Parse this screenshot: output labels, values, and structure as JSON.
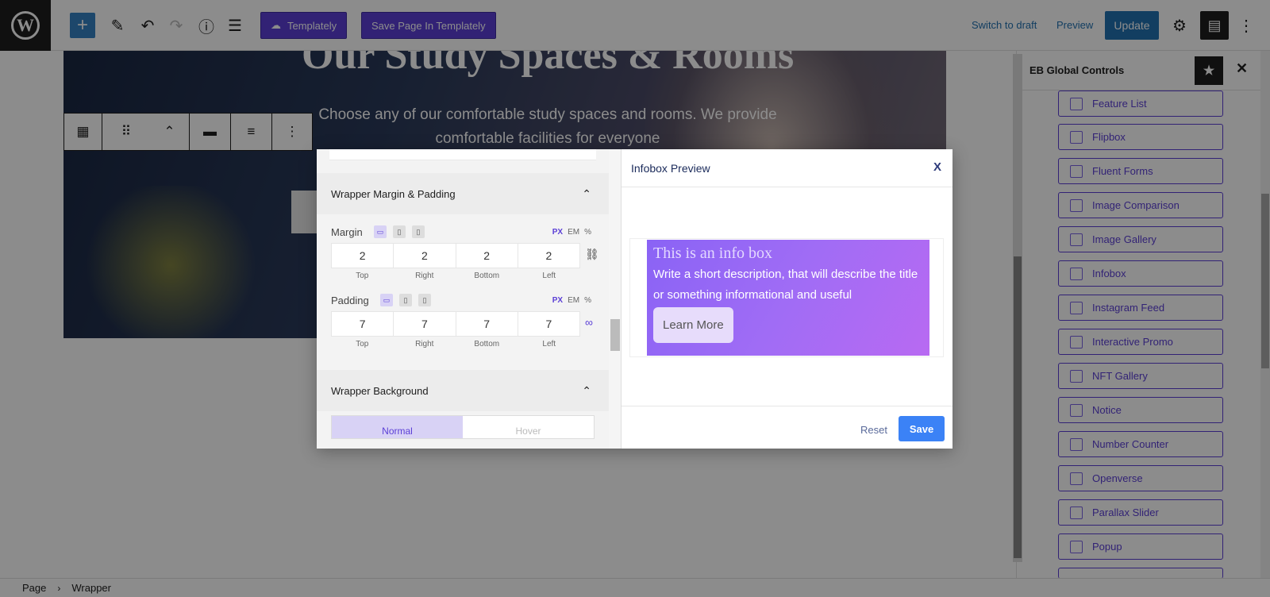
{
  "topbar": {
    "logo": "W",
    "add_icon": "+",
    "pen_icon": "✎",
    "undo_icon": "↶",
    "redo_icon": "↷",
    "info_icon": "ⓘ",
    "list_icon": "☰",
    "templately_label": "Templately",
    "save_templately_label": "Save Page In Templately",
    "switch_draft": "Switch to draft",
    "preview": "Preview",
    "update": "Update",
    "settings_icon": "⚙",
    "eb_icon": "▤",
    "more_icon": "⋮"
  },
  "hero": {
    "title": "Our Study Spaces & Rooms",
    "subtitle": "Choose any of our comfortable study spaces and rooms. We provide comfortable facilities for everyone"
  },
  "block_toolbar": {
    "block_icon": "▦",
    "drag_icon": "⠿",
    "move_icon": "⌃",
    "align_icon": "▬",
    "justify_icon": "≡",
    "more_icon": "⋮"
  },
  "sidebar": {
    "title": "EB Global Controls",
    "star_icon": "★",
    "close_icon": "✕",
    "items": [
      {
        "label": "Feature List"
      },
      {
        "label": "Flipbox"
      },
      {
        "label": "Fluent Forms"
      },
      {
        "label": "Image Comparison"
      },
      {
        "label": "Image Gallery"
      },
      {
        "label": "Infobox"
      },
      {
        "label": "Instagram Feed"
      },
      {
        "label": "Interactive Promo"
      },
      {
        "label": "NFT Gallery"
      },
      {
        "label": "Notice"
      },
      {
        "label": "Number Counter"
      },
      {
        "label": "Openverse"
      },
      {
        "label": "Parallax Slider"
      },
      {
        "label": "Popup"
      }
    ]
  },
  "footer": {
    "page": "Page",
    "separator": "›",
    "wrapper": "Wrapper"
  },
  "modal": {
    "section1_title": "Wrapper Margin & Padding",
    "section2_title": "Wrapper Background",
    "chevron": "⌃",
    "margin_label": "Margin",
    "padding_label": "Padding",
    "units": {
      "px": "PX",
      "em": "EM",
      "pct": "%"
    },
    "margin": {
      "top": "2",
      "right": "2",
      "bottom": "2",
      "left": "2"
    },
    "padding": {
      "top": "7",
      "right": "7",
      "bottom": "7",
      "left": "7"
    },
    "dim_labels": {
      "top": "Top",
      "right": "Right",
      "bottom": "Bottom",
      "left": "Left"
    },
    "unlink_icon": "⛓",
    "link_icon": "🔗",
    "tab_normal": "Normal",
    "tab_hover": "Hover",
    "preview_title": "Infobox Preview",
    "close": "X",
    "infobox_title": "This is an info box",
    "infobox_desc": "Write a short description, that will describe the title or something informational and useful",
    "infobox_button": "Learn More",
    "reset": "Reset",
    "save": "Save"
  },
  "colors": {
    "accent": "#5b3fd6",
    "wp_blue": "#2271b1",
    "save_blue": "#3b82f6"
  }
}
